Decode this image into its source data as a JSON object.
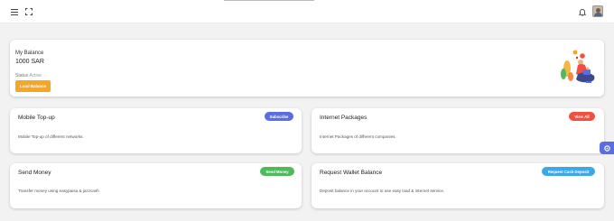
{
  "topbar": {
    "menu_icon": "hamburger-icon",
    "fullscreen_icon": "fullscreen-icon",
    "notification_icon": "bell-icon",
    "avatar": "user-avatar"
  },
  "balance": {
    "label": "My Balance",
    "amount": "1000 SAR",
    "status_label": "Status",
    "status_value": "Active",
    "load_button": "Load Balance"
  },
  "services": [
    {
      "title": "Mobile Top-up",
      "button": "Subscribe",
      "button_color": "#5b6ee1",
      "description": "Mobile Top-up of different networks."
    },
    {
      "title": "Internet Packages",
      "button": "View All",
      "button_color": "#f0503f",
      "description": "Internet Packages of different companies."
    },
    {
      "title": "Send Money",
      "button": "Send Money",
      "button_color": "#4cbb5a",
      "description": "Transfer money using easypaisa & jazzcash"
    },
    {
      "title": "Request Wallet Balance",
      "button": "Request Cash Deposit",
      "button_color": "#3ea7e8",
      "description": "Deposit balance in your account to use easy load & internet service."
    }
  ],
  "colors": {
    "load_button": "#f5a623",
    "side_tab": "#5b6ee1"
  },
  "side_tab_icon": "settings-icon"
}
